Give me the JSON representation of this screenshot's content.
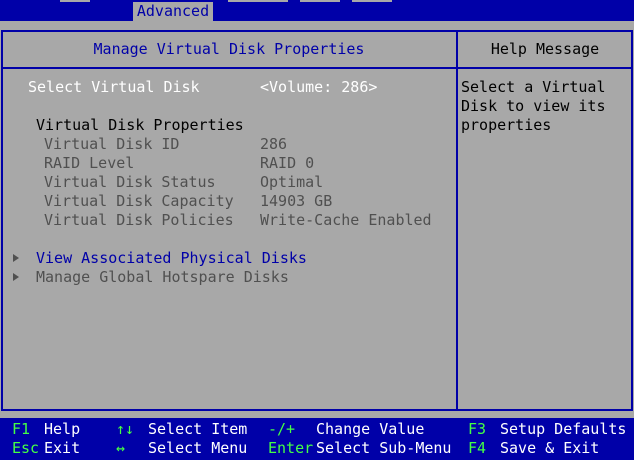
{
  "header": {
    "active_tab": "Advanced"
  },
  "main": {
    "title": "Manage Virtual Disk Properties",
    "select_label": "Select Virtual Disk",
    "select_value": "<Volume: 286>",
    "section_title": "Virtual Disk Properties",
    "properties": [
      {
        "label": "Virtual Disk ID",
        "value": "286"
      },
      {
        "label": "RAID Level",
        "value": "RAID 0"
      },
      {
        "label": "Virtual Disk Status",
        "value": "Optimal"
      },
      {
        "label": "Virtual Disk Capacity",
        "value": "14903 GB"
      },
      {
        "label": "Virtual Disk Policies",
        "value": "Write-Cache Enabled"
      }
    ],
    "links": [
      {
        "label": "View Associated Physical Disks"
      },
      {
        "label": "Manage Global Hotspare Disks"
      }
    ]
  },
  "help": {
    "title": "Help Message",
    "text": "Select a Virtual\nDisk to view its\nproperties"
  },
  "footer": {
    "keys": [
      {
        "key": "F1",
        "desc": "Help"
      },
      {
        "key": "Esc",
        "desc": "Exit"
      },
      {
        "key": "↑↓",
        "desc": "Select Item"
      },
      {
        "key": "↔",
        "desc": "Select Menu"
      },
      {
        "key": "-/+",
        "desc": "Change Value"
      },
      {
        "key": "Enter",
        "desc": "Select Sub-Menu"
      },
      {
        "key": "F3",
        "desc": "Setup Defaults"
      },
      {
        "key": "F4",
        "desc": "Save & Exit"
      }
    ]
  },
  "colors": {
    "frame_blue": "#0000a8",
    "background_grey": "#a8a8a8",
    "key_green": "#44ff44"
  }
}
